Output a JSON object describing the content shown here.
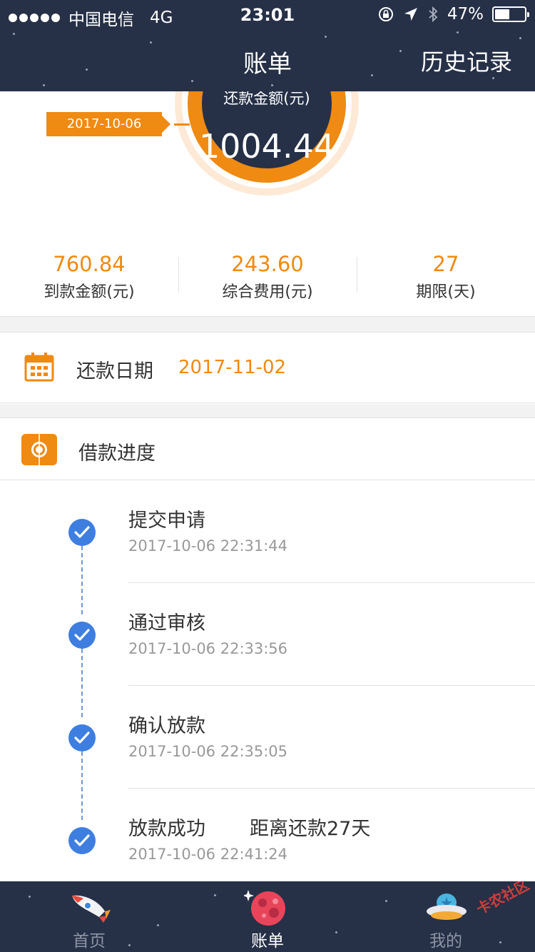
{
  "status_bar": {
    "carrier": "中国电信",
    "network": "4G",
    "time": "23:01",
    "battery": "47%"
  },
  "nav": {
    "title": "账单",
    "right_action": "历史记录"
  },
  "summary": {
    "ring_label": "还款金额(元)",
    "amount": "1004.44",
    "loan_date": "2017-10-06",
    "stats": [
      {
        "value": "760.84",
        "label": "到款金额(元)"
      },
      {
        "value": "243.60",
        "label": "综合费用(元)"
      },
      {
        "value": "27",
        "label": "期限(天)"
      }
    ]
  },
  "repayment": {
    "label": "还款日期",
    "date": "2017-11-02"
  },
  "progress": {
    "title": "借款进度",
    "steps": [
      {
        "name": "提交申请",
        "time": "2017-10-06 22:31:44",
        "extra": ""
      },
      {
        "name": "通过审核",
        "time": "2017-10-06 22:33:56",
        "extra": ""
      },
      {
        "name": "确认放款",
        "time": "2017-10-06 22:35:05",
        "extra": ""
      },
      {
        "name": "放款成功",
        "time": "2017-10-06 22:41:24",
        "extra": "距离还款27天"
      }
    ]
  },
  "tabs": [
    {
      "label": "首页",
      "icon": "rocket-icon"
    },
    {
      "label": "账单",
      "icon": "planet-icon"
    },
    {
      "label": "我的",
      "icon": "ufo-icon"
    }
  ],
  "watermark": "卡农社区",
  "colors": {
    "header_bg": "#263047",
    "accent_orange": "#ef8a12",
    "check_blue": "#3e7ee0"
  }
}
